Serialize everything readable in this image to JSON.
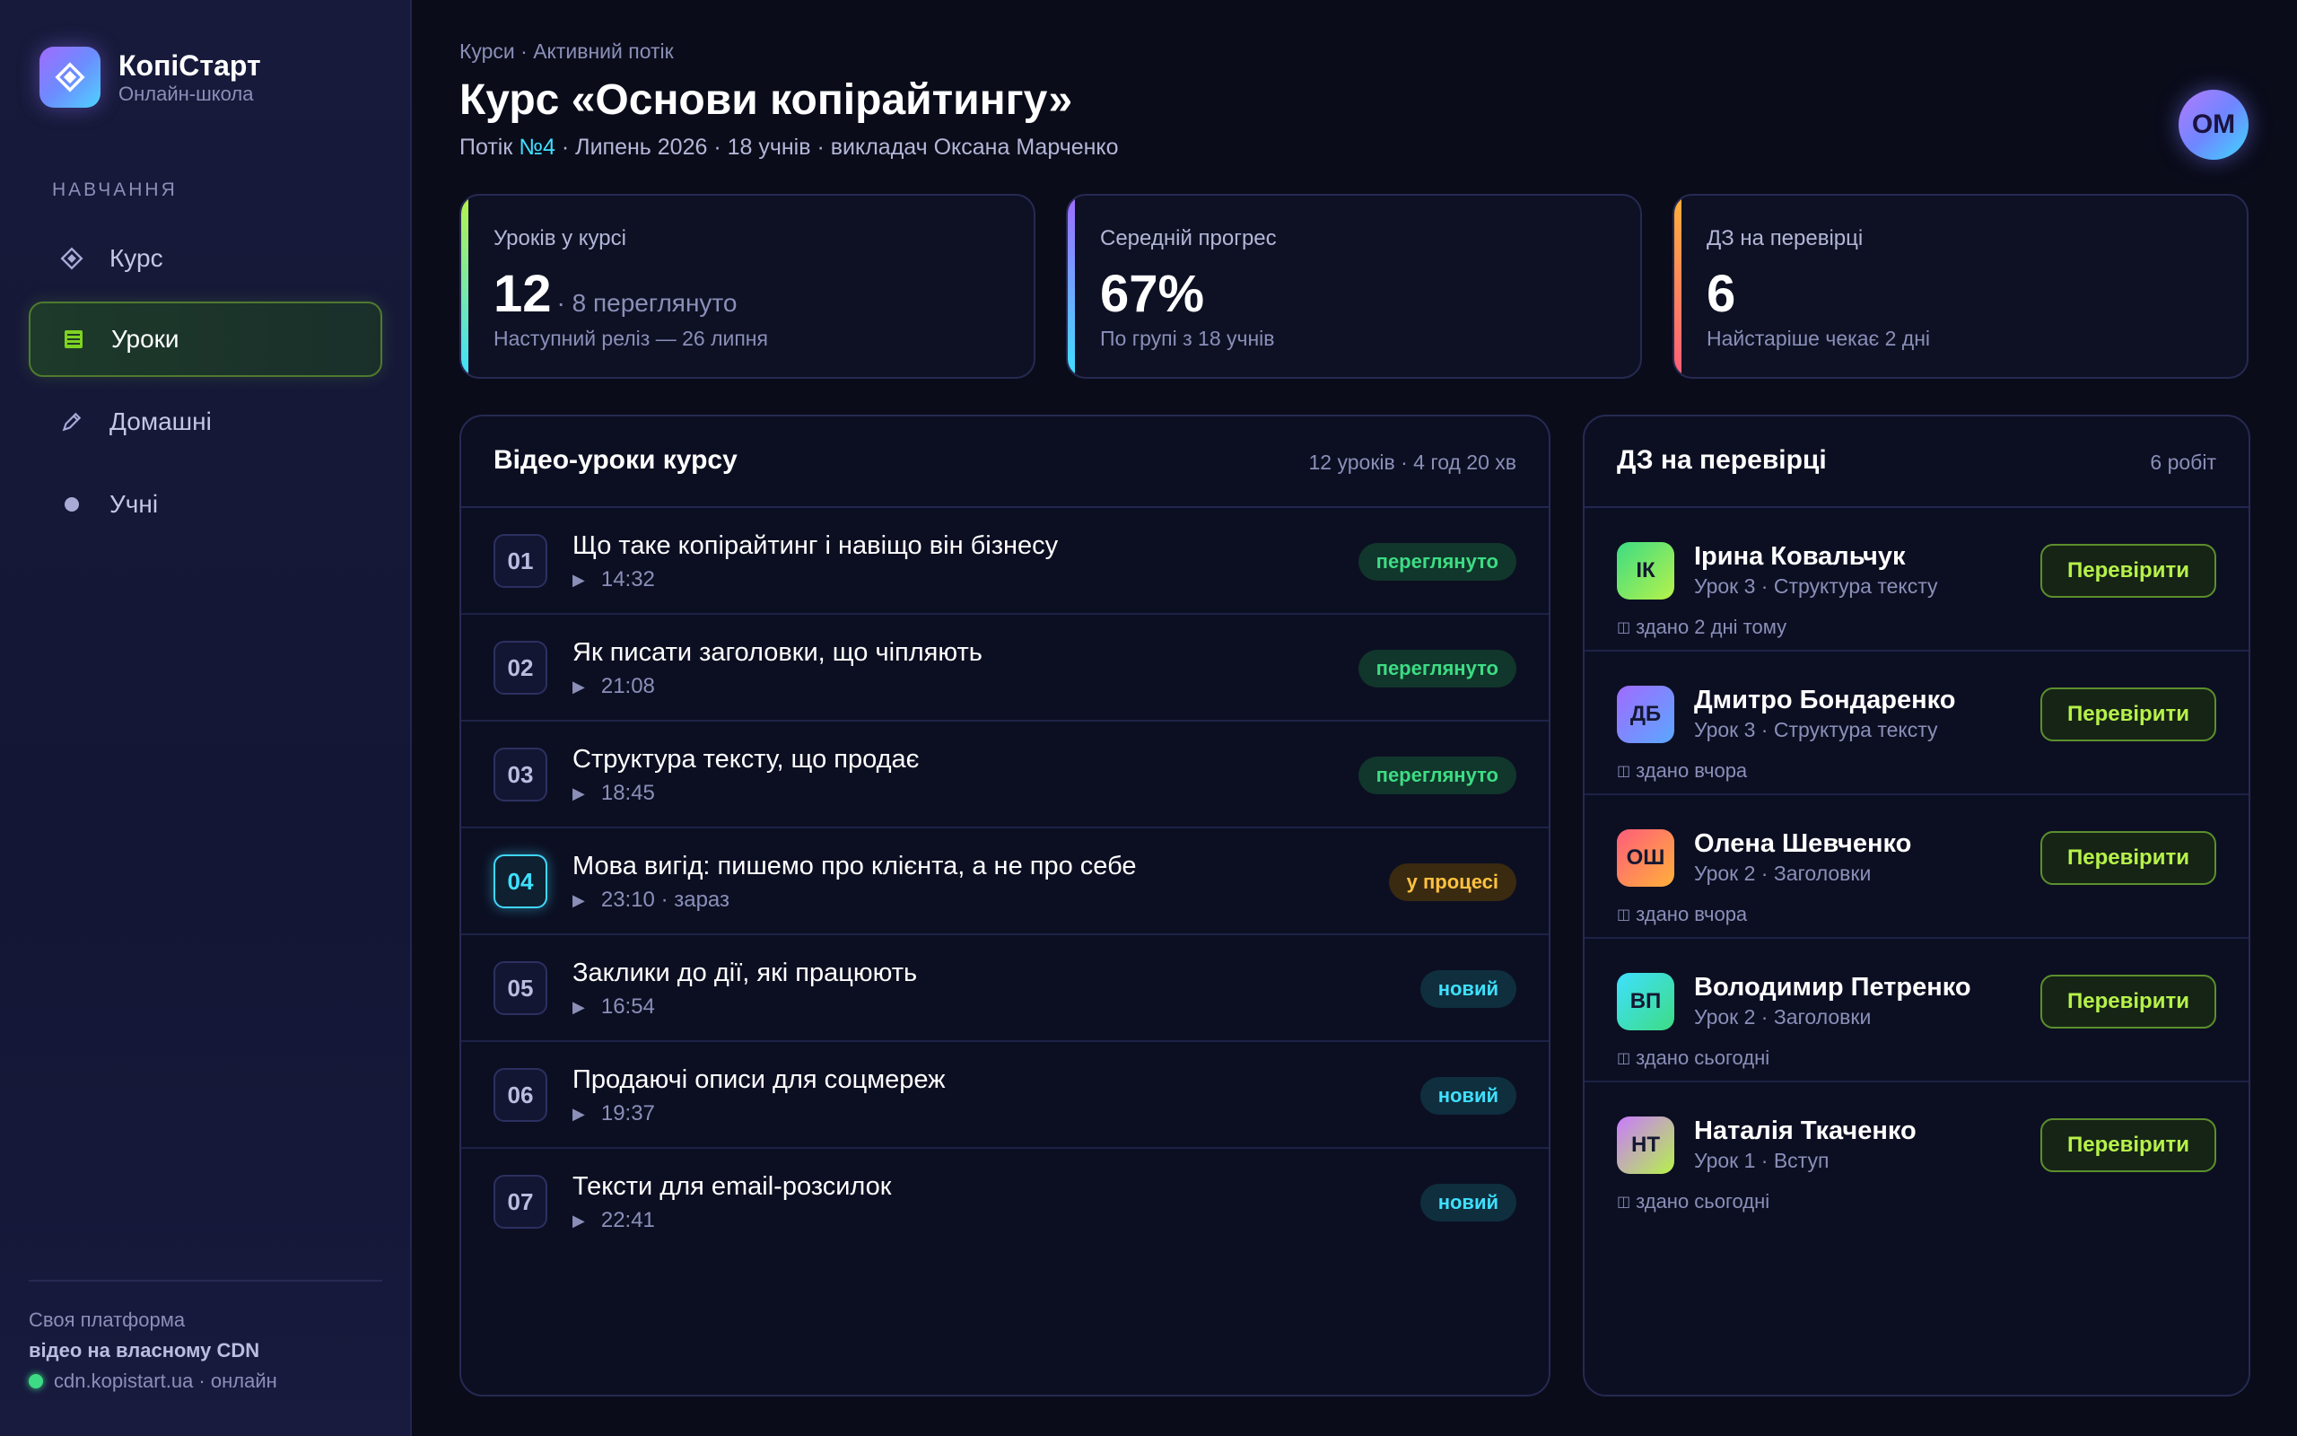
{
  "brand": {
    "name": "КопіСтарт",
    "subtitle": "Онлайн-школа",
    "logo_icon": "diamond-icon"
  },
  "sidebar": {
    "section_label": "НАВЧАННЯ",
    "items": [
      {
        "label": "Курс",
        "icon": "diamond-icon",
        "active": false
      },
      {
        "label": "Уроки",
        "icon": "list-icon",
        "active": true
      },
      {
        "label": "Домашні",
        "icon": "pencil-icon",
        "active": false
      },
      {
        "label": "Учні",
        "icon": "dot-icon",
        "active": false
      }
    ],
    "footer": {
      "line1": "Своя платформа",
      "line2": "відео на власному CDN",
      "status": "cdn.kopistart.ua · онлайн"
    }
  },
  "header": {
    "breadcrumb": "Курси · Активний потік",
    "title": "Курс «Основи копірайтингу»",
    "sub_prefix": "Потік",
    "sub_stream": "№4",
    "sub_rest": "· Липень 2026 · 18 учнів · викладач Оксана Марченко",
    "avatar_initials": "ОМ"
  },
  "stats": [
    {
      "label": "Уроків у курсі",
      "value": "12",
      "extra": "· 8 переглянуто",
      "note": "Наступний реліз — 26 липня"
    },
    {
      "label": "Середній прогрес",
      "value": "67%",
      "extra": "",
      "note": "По групі з 18 учнів"
    },
    {
      "label": "ДЗ на перевірці",
      "value": "6",
      "extra": "",
      "note": "Найстаріше чекає 2 дні"
    }
  ],
  "lessons_panel": {
    "title": "Відео-уроки курсу",
    "meta": "12 уроків · 4 год 20 хв",
    "lessons": [
      {
        "num": "01",
        "title": "Що таке копірайтинг і навіщо він бізнесу",
        "meta": "14:32",
        "badge": "переглянуто",
        "status": "watched"
      },
      {
        "num": "02",
        "title": "Як писати заголовки, що чіпляють",
        "meta": "21:08",
        "badge": "переглянуто",
        "status": "watched"
      },
      {
        "num": "03",
        "title": "Структура тексту, що продає",
        "meta": "18:45",
        "badge": "переглянуто",
        "status": "watched"
      },
      {
        "num": "04",
        "title": "Мова вигід: пишемо про клієнта, а не про себе",
        "meta": "23:10 · зараз",
        "badge": "у процесі",
        "status": "progress"
      },
      {
        "num": "05",
        "title": "Заклики до дії, які працюють",
        "meta": "16:54",
        "badge": "новий",
        "status": "new"
      },
      {
        "num": "06",
        "title": "Продаючі описи для соцмереж",
        "meta": "19:37",
        "badge": "новий",
        "status": "new"
      },
      {
        "num": "07",
        "title": "Тексти для email-розсилок",
        "meta": "22:41",
        "badge": "новий",
        "status": "new"
      }
    ]
  },
  "homework_panel": {
    "title": "ДЗ на перевірці",
    "meta": "6 робіт",
    "button_label": "Перевірити",
    "items": [
      {
        "initials": "ІК",
        "name": "Ірина Ковальчук",
        "lesson": "Урок 3 · Структура тексту",
        "when": "здано 2 дні тому",
        "gradient": [
          "#3ddc84",
          "#b6f24a"
        ]
      },
      {
        "initials": "ДБ",
        "name": "Дмитро Бондаренко",
        "lesson": "Урок 3 · Структура тексту",
        "when": "здано вчора",
        "gradient": [
          "#a06bff",
          "#5aa8ff"
        ]
      },
      {
        "initials": "ОШ",
        "name": "Олена Шевченко",
        "lesson": "Урок 2 · Заголовки",
        "when": "здано вчора",
        "gradient": [
          "#ff5d7a",
          "#ffb03a"
        ]
      },
      {
        "initials": "ВП",
        "name": "Володимир Петренко",
        "lesson": "Урок 2 · Заголовки",
        "when": "здано сьогодні",
        "gradient": [
          "#3fe0ff",
          "#3ddc84"
        ]
      },
      {
        "initials": "НТ",
        "name": "Наталія Ткаченко",
        "lesson": "Урок 1 · Вступ",
        "when": "здано сьогодні",
        "gradient": [
          "#c97aff",
          "#b6f24a"
        ]
      }
    ]
  },
  "colors": {
    "accent_cyan": "#3fe0ff",
    "accent_green": "#3ddc84",
    "accent_lime": "#b6f24a",
    "accent_orange": "#ffc240",
    "background": "#0a0c1a"
  }
}
